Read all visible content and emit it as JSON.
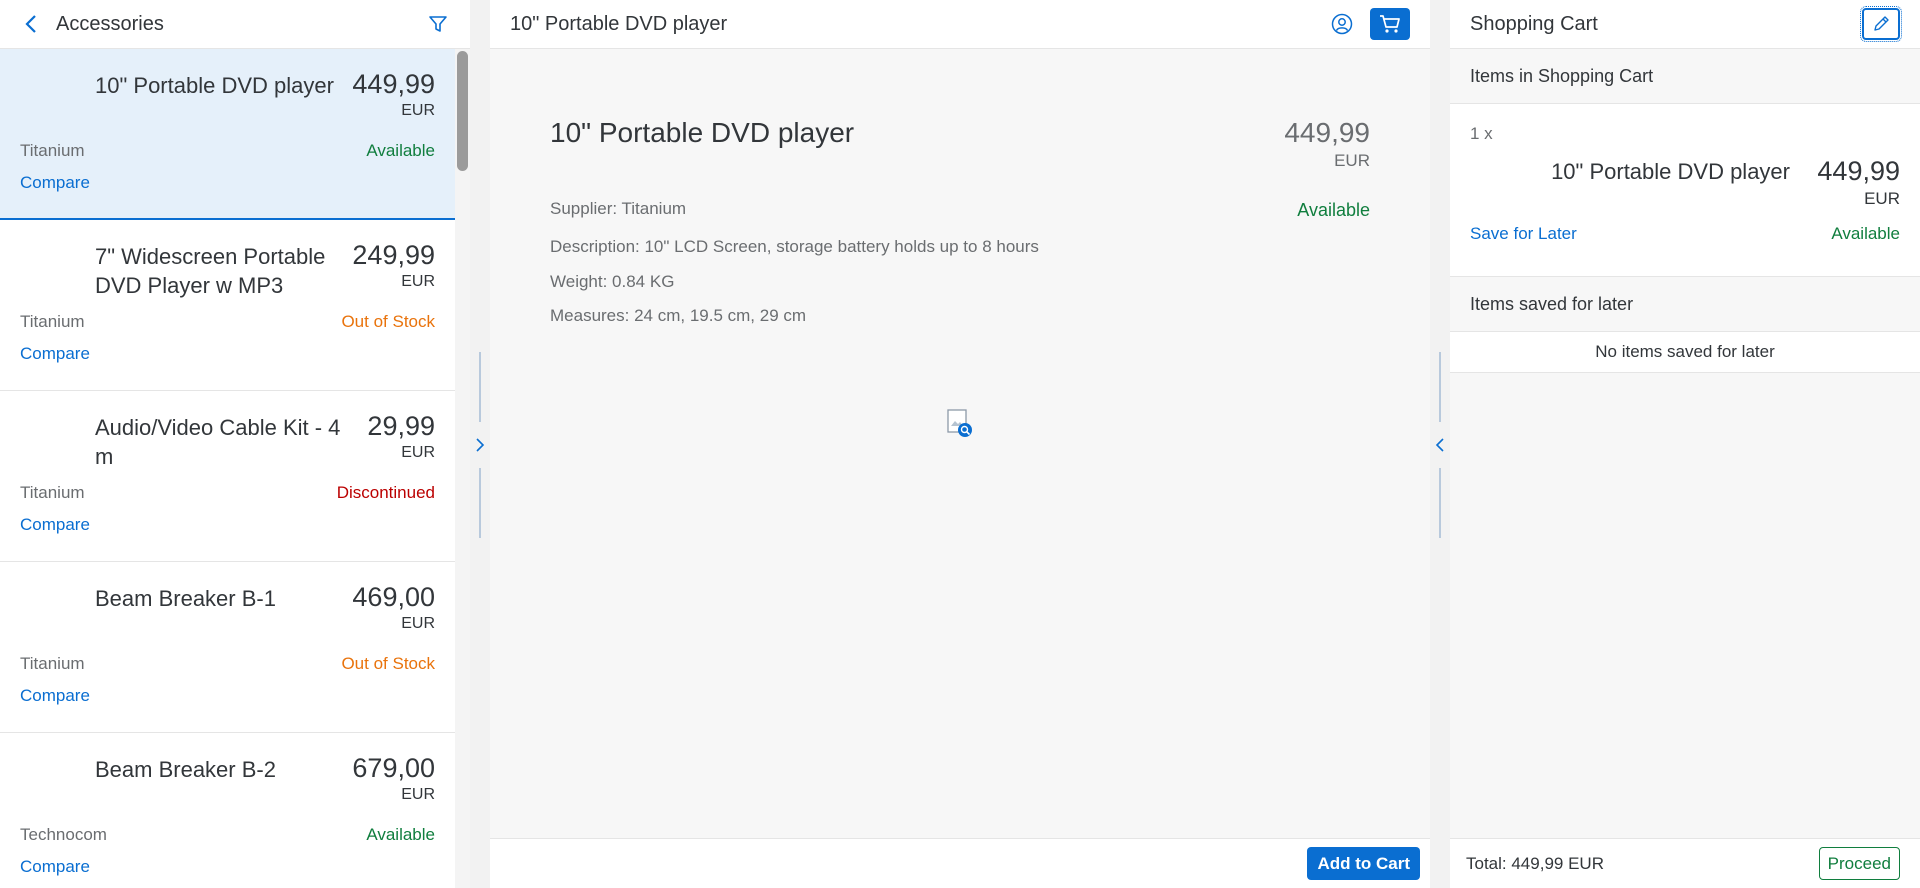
{
  "colors": {
    "accent": "#0a6ed1",
    "available": "#107e3e",
    "out_of_stock": "#e9730c",
    "discontinued": "#bb0000"
  },
  "left": {
    "title": "Accessories",
    "back_icon": "chevron-left-icon",
    "filter_icon": "filter-icon",
    "items": [
      {
        "name": "10\" Portable DVD player",
        "price": "449,99",
        "currency": "EUR",
        "supplier": "Titanium",
        "status": "Available",
        "compare": "Compare"
      },
      {
        "name": "7\" Widescreen Portable DVD Player w MP3",
        "price": "249,99",
        "currency": "EUR",
        "supplier": "Titanium",
        "status": "Out of Stock",
        "compare": "Compare"
      },
      {
        "name": "Audio/Video Cable Kit - 4m",
        "price": "29,99",
        "currency": "EUR",
        "supplier": "Titanium",
        "status": "Discontinued",
        "compare": "Compare"
      },
      {
        "name": "Beam Breaker B-1",
        "price": "469,00",
        "currency": "EUR",
        "supplier": "Titanium",
        "status": "Out of Stock",
        "compare": "Compare"
      },
      {
        "name": "Beam Breaker B-2",
        "price": "679,00",
        "currency": "EUR",
        "supplier": "Technocom",
        "status": "Available",
        "compare": "Compare"
      }
    ]
  },
  "middle": {
    "header_title": "10\" Portable DVD player",
    "user_icon": "user-icon",
    "cart_icon": "cart-icon",
    "title": "10\" Portable DVD player",
    "price": "449,99",
    "currency": "EUR",
    "supplier": "Supplier: Titanium",
    "status": "Available",
    "description": "Description: 10\" LCD Screen, storage battery holds up to 8 hours",
    "weight": "Weight: 0.84 KG",
    "measures": "Measures: 24 cm, 19.5 cm, 29 cm",
    "add_to_cart": "Add to Cart"
  },
  "right": {
    "title": "Shopping Cart",
    "edit_icon": "edit-icon",
    "items_heading": "Items in Shopping Cart",
    "cart_item": {
      "quantity": "1 x",
      "name": "10\" Portable DVD player",
      "price": "449,99",
      "currency": "EUR",
      "save_for_later": "Save for Later",
      "status": "Available"
    },
    "saved_heading": "Items saved for later",
    "saved_empty": "No items saved for later",
    "total": "Total: 449,99 EUR",
    "proceed": "Proceed"
  }
}
